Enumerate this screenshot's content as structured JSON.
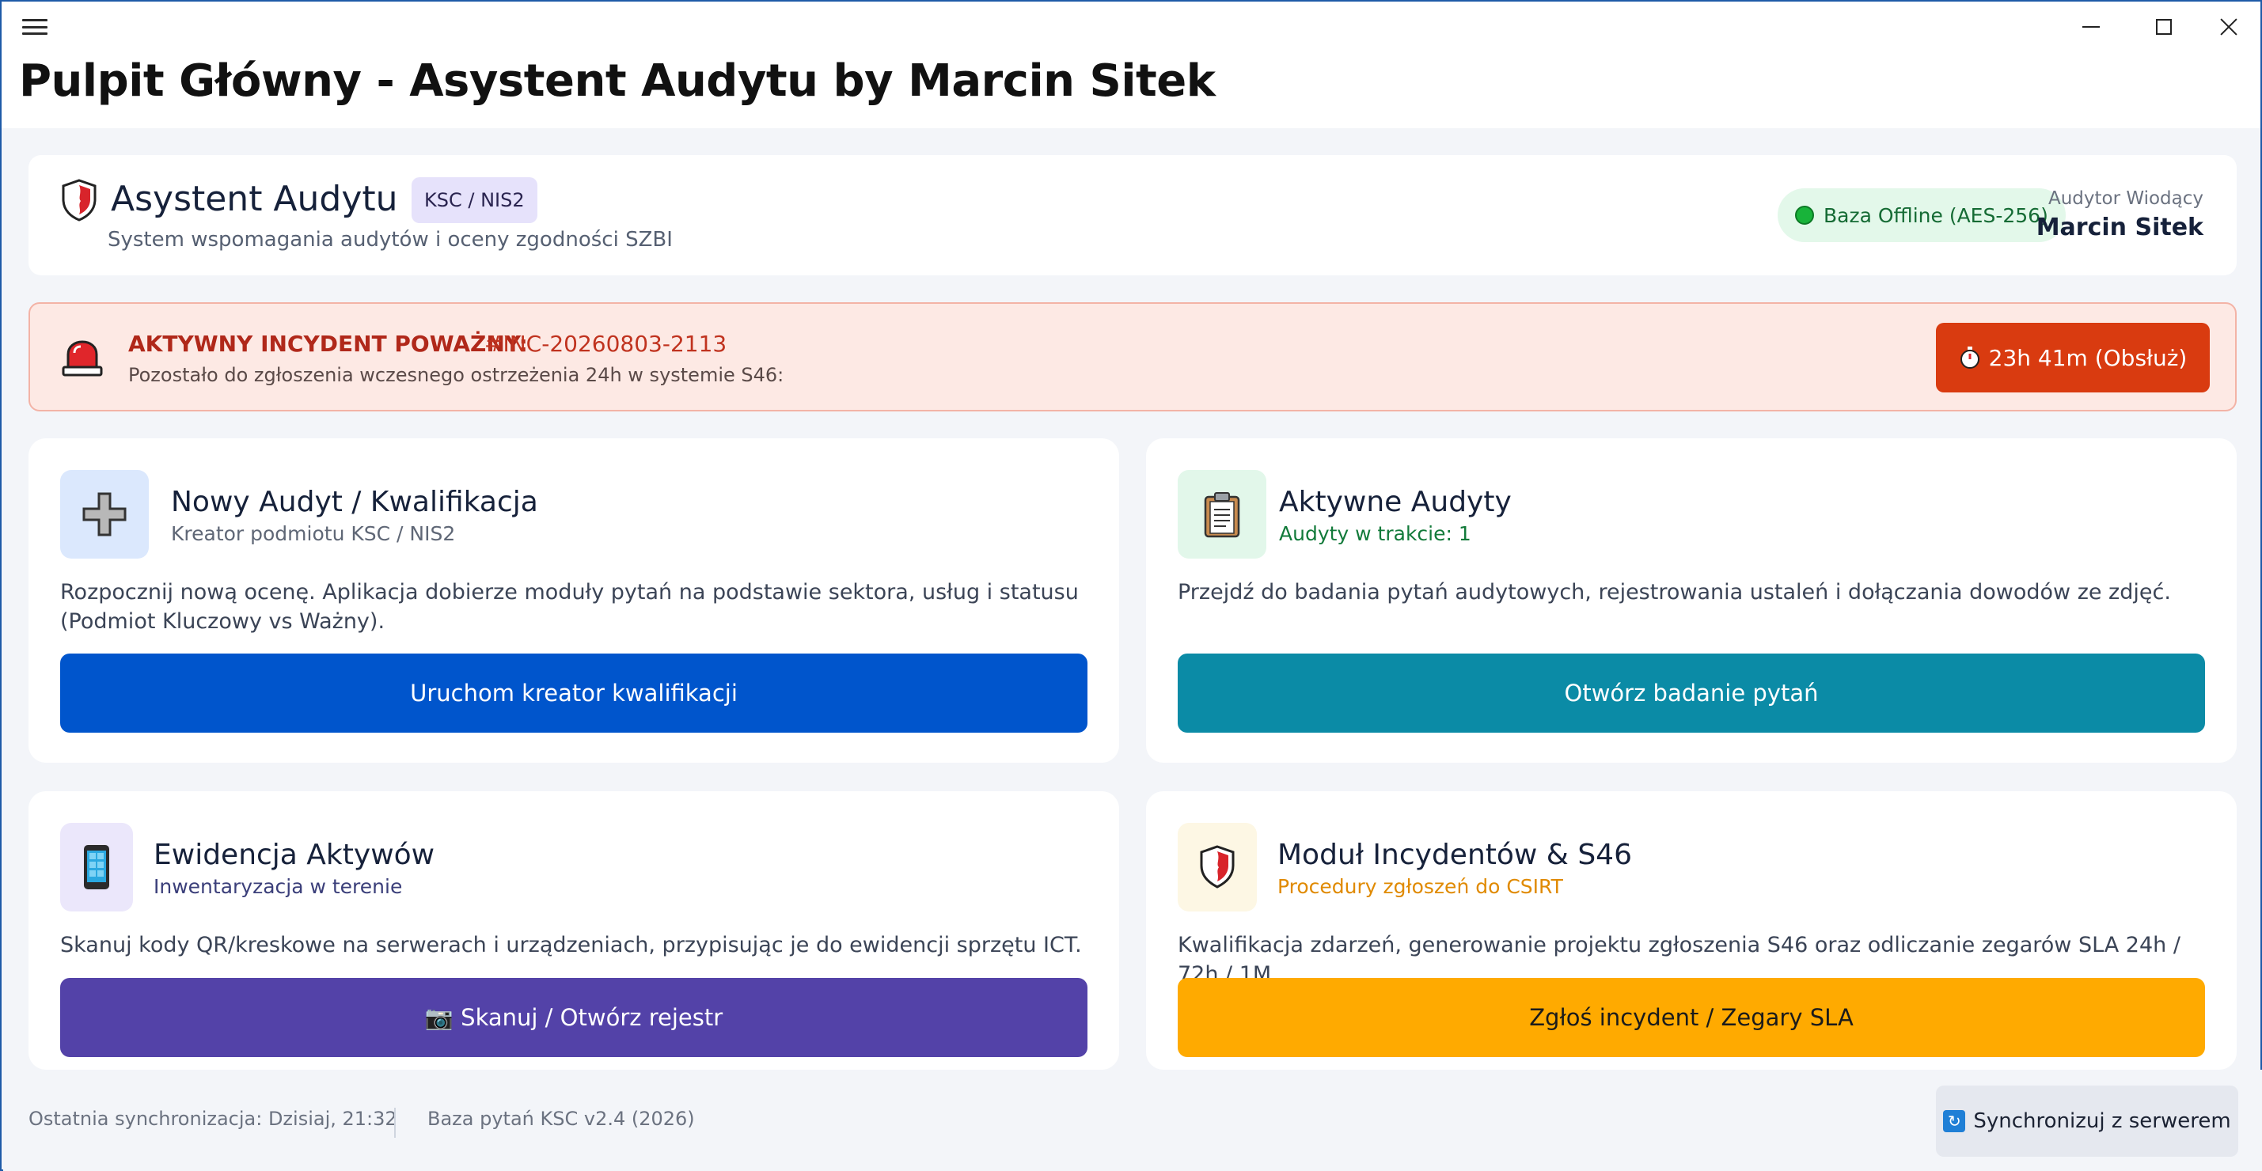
{
  "window": {
    "title": "Pulpit Główny - Asystent Audytu by Marcin Sitek"
  },
  "header": {
    "app_name": "Asystent Audytu",
    "norm_badge": "KSC / NIS2",
    "subtitle": "System wspomagania audytów i oceny zgodności SZBI",
    "db_status": "Baza Offline (AES-256)",
    "auditor_label": "Audytor Wiodący",
    "auditor_name": "Marcin Sitek"
  },
  "incident": {
    "title": "AKTYWNY INCYDENT POWAŻNY:",
    "id": "#INC-20260803-2113",
    "subtitle": "Pozostało do zgłoszenia wczesnego ostrzeżenia 24h w systemie S46:",
    "button_label": "23h 41m (Obsłuż)"
  },
  "modules": [
    {
      "title": "Nowy Audyt / Kwalifikacja",
      "subtitle": "Kreator podmiotu KSC / NIS2",
      "description": "Rozpocznij nową ocenę. Aplikacja dobierze moduły pytań na podstawie sektora, usług i statusu (Podmiot Kluczowy vs Ważny).",
      "button_label": "Uruchom kreator kwalifikacji",
      "icon": "plus-icon",
      "accent": "#0055cc",
      "icon_bg": "#dbe8fd",
      "subtitle_color": "#5f6776"
    },
    {
      "title": "Aktywne Audyty",
      "subtitle": "Audyty w trakcie: 1",
      "description": "Przejdź do badania pytań audytowych, rejestrowania ustaleń i dołączania dowodów ze zdjęć.",
      "button_label": "Otwórz badanie pytań",
      "icon": "clipboard-icon",
      "accent": "#0b8ba6",
      "icon_bg": "#e2f7ea",
      "subtitle_color": "#127a3a"
    },
    {
      "title": "Ewidencja Aktywów",
      "subtitle": "Inwentaryzacja w terenie",
      "description": "Skanuj kody QR/kreskowe na serwerach i urządzeniach, przypisując je do ewidencji sprzętu ICT.",
      "button_label": "📷 Skanuj / Otwórz rejestr",
      "icon": "mobile-phone-icon",
      "accent": "#5342a8",
      "icon_bg": "#ebe7fb",
      "subtitle_color": "#3b3f7a"
    },
    {
      "title": "Moduł Incydentów & S46",
      "subtitle": "Procedury zgłoszeń do CSIRT",
      "description": "Kwalifikacja zdarzeń, generowanie projektu zgłoszenia S46 oraz odliczanie zegarów SLA 24h / 72h / 1M.",
      "button_label": "Zgłoś incydent / Zegary SLA",
      "icon": "shield-icon",
      "accent": "#ffaa00",
      "icon_bg": "#fdf7e4",
      "subtitle_color": "#e08a00"
    }
  ],
  "footer": {
    "last_sync": "Ostatnia synchronizacja: Dzisiaj, 21:32",
    "db_version": "Baza pytań KSC v2.4 (2026)",
    "sync_button": "Synchronizuj z serwerem"
  }
}
